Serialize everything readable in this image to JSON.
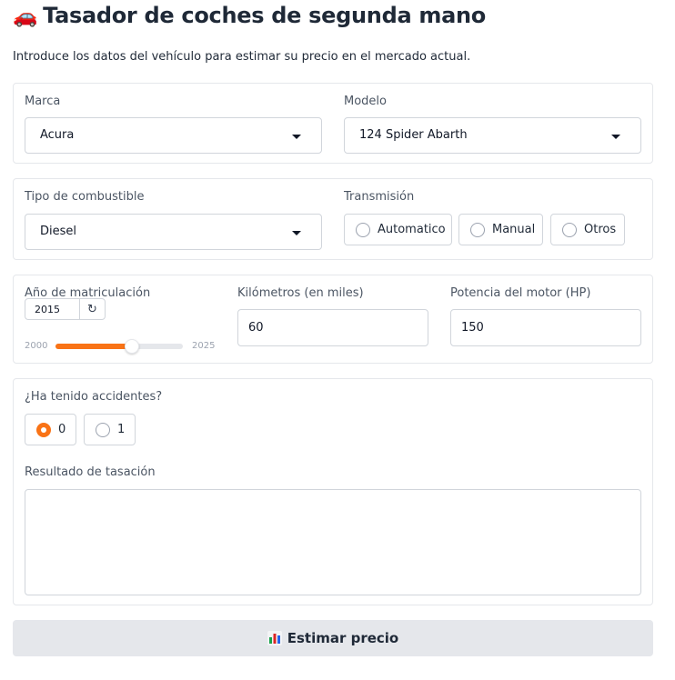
{
  "header": {
    "title_icon": "car-icon",
    "title": "Tasador de coches de segunda mano",
    "subtitle": "Introduce los datos del vehículo para estimar su precio en el mercado actual."
  },
  "brand": {
    "label": "Marca",
    "value": "Acura"
  },
  "model": {
    "label": "Modelo",
    "value": "124 Spider Abarth"
  },
  "fuel": {
    "label": "Tipo de combustible",
    "value": "Diesel"
  },
  "transmission": {
    "label": "Transmisión",
    "options": [
      "Automatico",
      "Manual",
      "Otros"
    ],
    "selected": null
  },
  "year": {
    "label": "Año de matriculación",
    "value": "2015",
    "min": "2000",
    "max": "2025",
    "fraction": 0.6
  },
  "km": {
    "label": "Kilómetros (en miles)",
    "value": "60"
  },
  "power": {
    "label": "Potencia del motor (HP)",
    "value": "150"
  },
  "accidents": {
    "label": "¿Ha tenido accidentes?",
    "options": [
      "0",
      "1"
    ],
    "selected": "0"
  },
  "result": {
    "label": "Resultado de tasación",
    "value": ""
  },
  "submit": {
    "icon": "bar-chart-icon",
    "label": "Estimar precio"
  },
  "colors": {
    "accent": "#f97316",
    "border": "#e5e7eb",
    "button_bg": "#e5e7eb"
  }
}
